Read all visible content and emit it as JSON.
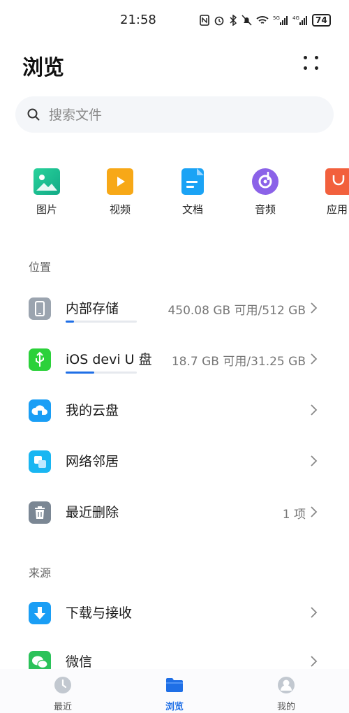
{
  "status_bar": {
    "time": "21:58",
    "icons": [
      "nfc-icon",
      "alarm-icon",
      "bluetooth-icon",
      "mute-icon",
      "wifi-icon",
      "signal-5g-icon",
      "signal-4g-icon"
    ],
    "battery": "74"
  },
  "header": {
    "title": "浏览",
    "more_icon": "more-dots-icon"
  },
  "search": {
    "placeholder": "搜索文件"
  },
  "categories": [
    {
      "label": "图片",
      "icon": "image-icon",
      "color": "#1fbf8f"
    },
    {
      "label": "视频",
      "icon": "video-icon",
      "color": "#f7a817"
    },
    {
      "label": "文档",
      "icon": "document-icon",
      "color": "#1ba3f5"
    },
    {
      "label": "音频",
      "icon": "audio-icon",
      "color": "#8b62e8"
    },
    {
      "label": "应用",
      "icon": "app-icon",
      "color": "#f2603d"
    }
  ],
  "locations": {
    "label": "位置",
    "items": [
      {
        "title": "内部存储",
        "info": "450.08 GB 可用/512 GB",
        "icon": "phone-storage-icon",
        "color": "#9ba4af",
        "usage_fraction": 0.12
      },
      {
        "title": "iOS devi U 盘",
        "info": "18.7 GB 可用/31.25 GB",
        "icon": "usb-icon",
        "color": "#2bd13a",
        "usage_fraction": 0.4
      },
      {
        "title": "我的云盘",
        "info": "",
        "icon": "cloud-drive-icon",
        "color": "#1a9ef5"
      },
      {
        "title": "网络邻居",
        "info": "",
        "icon": "network-neighbor-icon",
        "color": "#19b6f2"
      },
      {
        "title": "最近删除",
        "info": "1 项",
        "icon": "trash-icon",
        "color": "#7b8794"
      }
    ]
  },
  "sources": {
    "label": "来源",
    "items": [
      {
        "title": "下载与接收",
        "info": "",
        "icon": "download-icon",
        "color": "#1a9ef5"
      },
      {
        "title": "微信",
        "info": "",
        "icon": "wechat-icon",
        "color": "#2bc25a"
      }
    ]
  },
  "bottom_nav": {
    "items": [
      {
        "label": "最近",
        "icon": "clock-icon"
      },
      {
        "label": "浏览",
        "icon": "folder-icon",
        "active": true
      },
      {
        "label": "我的",
        "icon": "profile-icon"
      }
    ]
  },
  "colors": {
    "accent": "#1f6fe6",
    "background": "#ffffff",
    "search_bg": "#f4f6f9"
  }
}
